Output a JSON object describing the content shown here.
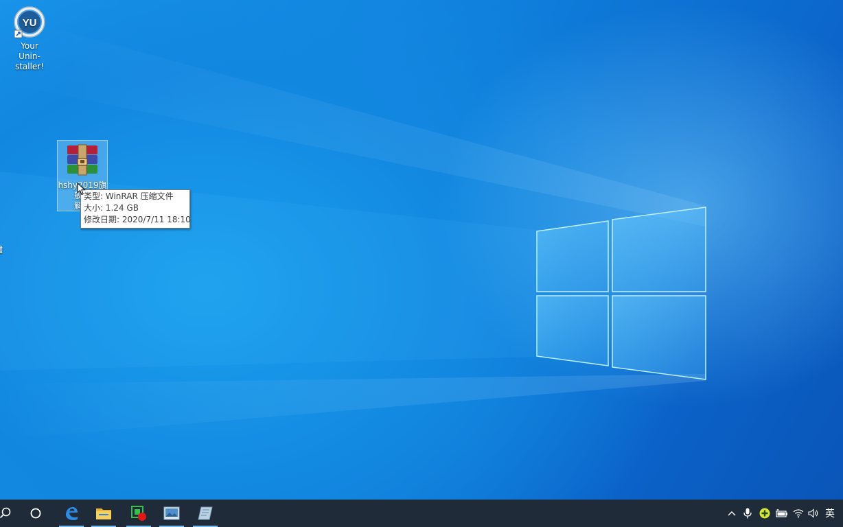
{
  "desktop": {
    "icons": [
      {
        "name": "Your Unin-staller!",
        "line1": "Your",
        "line2": "Unin-staller!"
      },
      {
        "name": "hshy2019旗舰版 解压",
        "line1": "hshy2019旗",
        "line2": "舰版",
        "line3": "解压"
      }
    ],
    "edge_fragments": [
      "。",
      "贐"
    ]
  },
  "tooltip": {
    "type": "类型: WinRAR 压缩文件",
    "size": "大小: 1.24 GB",
    "modified": "修改日期: 2020/7/11 18:10"
  },
  "taskbar": {
    "pinned": [
      "search-icon",
      "cortana-icon",
      "edge-icon",
      "file-explorer-icon",
      "screen-recorder-icon",
      "photos-icon",
      "notepad-icon"
    ],
    "tray": {
      "input_method": "英"
    }
  },
  "colors": {
    "taskbar": "#1f2b38",
    "accent": "#76b9ed",
    "wallpaper": "#0f7fdc"
  }
}
